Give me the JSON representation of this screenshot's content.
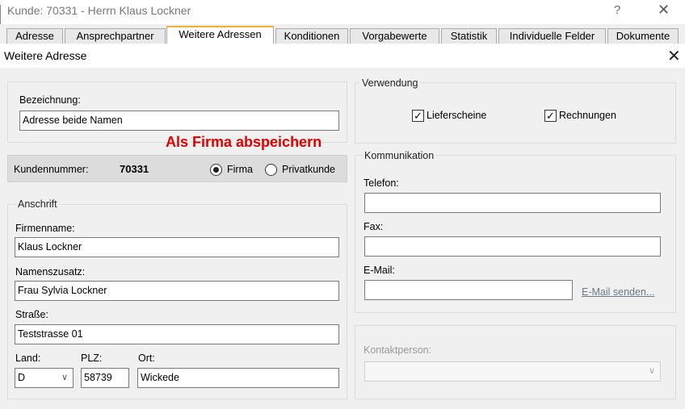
{
  "window": {
    "title": "Kunde: 70331 - Herrn Klaus Lockner",
    "help_label": "?",
    "close_label": "✕"
  },
  "tabs": [
    {
      "label": "Adresse"
    },
    {
      "label": "Ansprechpartner"
    },
    {
      "label": "Weitere Adressen",
      "active": true
    },
    {
      "label": "Konditionen"
    },
    {
      "label": "Vorgabewerte"
    },
    {
      "label": "Statistik"
    },
    {
      "label": "Individuelle Felder"
    },
    {
      "label": "Dokumente"
    }
  ],
  "dialog": {
    "title": "Weitere Adresse",
    "close_label": "✕",
    "bezeichnung": {
      "label": "Bezeichnung:",
      "value": "Adresse beide Namen"
    },
    "annotation": "Als Firma abspeichern",
    "kundennummer": {
      "label": "Kundennummer:",
      "value": "70331"
    },
    "type": {
      "firma_label": "Firma",
      "privat_label": "Privatkunde",
      "selected": "Firma"
    },
    "anschrift": {
      "legend": "Anschrift",
      "firmenname": {
        "label": "Firmenname:",
        "value": "Klaus Lockner"
      },
      "namenszusatz": {
        "label": "Namenszusatz:",
        "value": "Frau Sylvia Lockner"
      },
      "strasse": {
        "label": "Straße:",
        "value": "Teststrasse 01"
      },
      "land": {
        "label": "Land:",
        "value": "D"
      },
      "plz": {
        "label": "PLZ:",
        "value": "58739"
      },
      "ort": {
        "label": "Ort:",
        "value": "Wickede"
      }
    },
    "verwendung": {
      "legend": "Verwendung",
      "lieferscheine": {
        "label": "Lieferscheine",
        "checked": true
      },
      "rechnungen": {
        "label": "Rechnungen",
        "checked": true
      }
    },
    "kommunikation": {
      "legend": "Kommunikation",
      "telefon": {
        "label": "Telefon:",
        "value": ""
      },
      "fax": {
        "label": "Fax:",
        "value": ""
      },
      "email": {
        "label": "E-Mail:",
        "value": ""
      },
      "email_send_label": "E-Mail senden..."
    },
    "kontaktperson": {
      "label": "Kontaktperson:",
      "value": ""
    }
  }
}
